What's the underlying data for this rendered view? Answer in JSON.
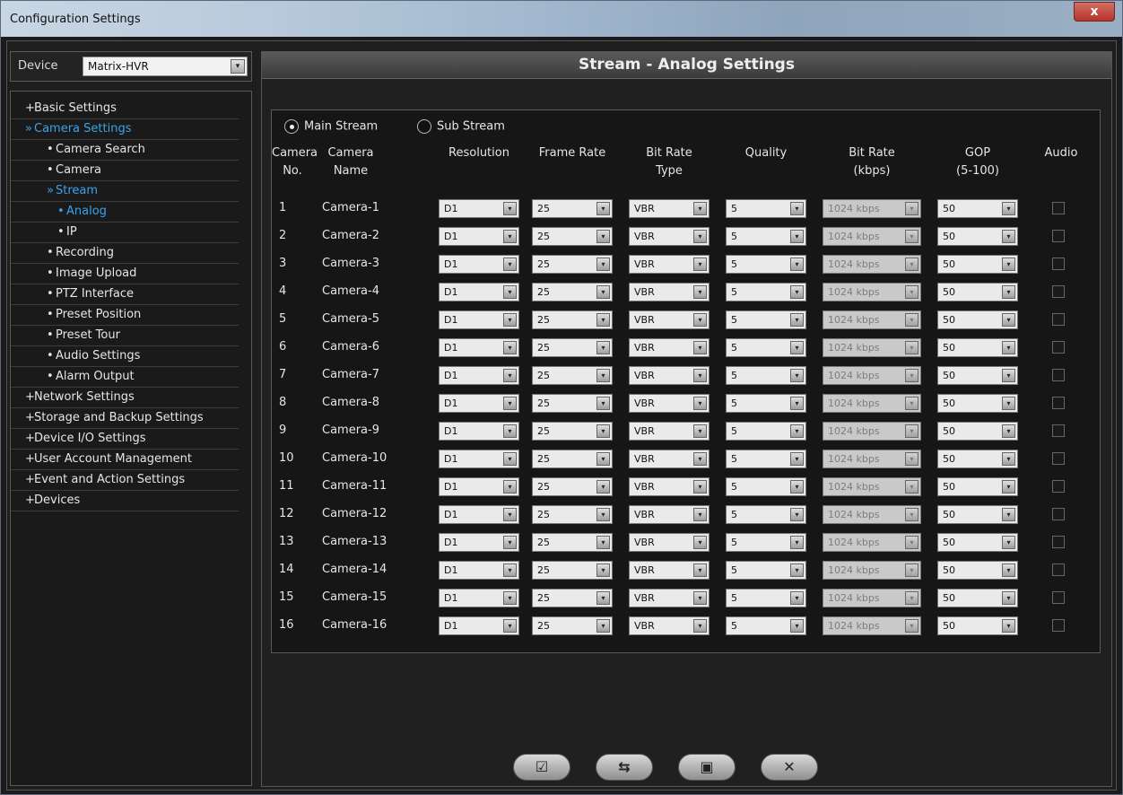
{
  "window": {
    "title": "Configuration Settings",
    "close_glyph": "x"
  },
  "device": {
    "label": "Device",
    "value": "Matrix-HVR",
    "arrow_glyph": "▾"
  },
  "tree": [
    {
      "label": "Basic Settings",
      "bullet": "+",
      "level": 0,
      "active": false
    },
    {
      "label": "Camera Settings",
      "bullet": "»",
      "level": 0,
      "active": true
    },
    {
      "label": "Camera Search",
      "bullet": "•",
      "level": 1,
      "active": false
    },
    {
      "label": "Camera",
      "bullet": "•",
      "level": 1,
      "active": false
    },
    {
      "label": "Stream",
      "bullet": "»",
      "level": 1,
      "active": true
    },
    {
      "label": "Analog",
      "bullet": "•",
      "level": 2,
      "active": true
    },
    {
      "label": "IP",
      "bullet": "•",
      "level": 2,
      "active": false
    },
    {
      "label": "Recording",
      "bullet": "•",
      "level": 1,
      "active": false
    },
    {
      "label": "Image Upload",
      "bullet": "•",
      "level": 1,
      "active": false
    },
    {
      "label": "PTZ Interface",
      "bullet": "•",
      "level": 1,
      "active": false
    },
    {
      "label": "Preset Position",
      "bullet": "•",
      "level": 1,
      "active": false
    },
    {
      "label": "Preset Tour",
      "bullet": "•",
      "level": 1,
      "active": false
    },
    {
      "label": "Audio Settings",
      "bullet": "•",
      "level": 1,
      "active": false
    },
    {
      "label": "Alarm Output",
      "bullet": "•",
      "level": 1,
      "active": false
    },
    {
      "label": "Network Settings",
      "bullet": "+",
      "level": 0,
      "active": false
    },
    {
      "label": "Storage and Backup Settings",
      "bullet": "+",
      "level": 0,
      "active": false
    },
    {
      "label": "Device I/O Settings",
      "bullet": "+",
      "level": 0,
      "active": false
    },
    {
      "label": "User Account Management",
      "bullet": "+",
      "level": 0,
      "active": false
    },
    {
      "label": "Event and Action Settings",
      "bullet": "+",
      "level": 0,
      "active": false
    },
    {
      "label": "Devices",
      "bullet": "+",
      "level": 0,
      "active": false
    }
  ],
  "main": {
    "title": "Stream - Analog Settings",
    "radio_main": "Main Stream",
    "radio_sub": "Sub Stream",
    "selected_stream": "main",
    "headers": {
      "camera_no": "Camera No.",
      "camera_no_l1": "Camera",
      "camera_no_l2": "No.",
      "camera_name_l1": "Camera",
      "camera_name_l2": "Name",
      "resolution": "Resolution",
      "frame_rate": "Frame Rate",
      "bitrate_type_l1": "Bit Rate",
      "bitrate_type_l2": "Type",
      "quality": "Quality",
      "bitrate_l1": "Bit Rate",
      "bitrate_l2": "(kbps)",
      "gop_l1": "GOP",
      "gop_l2": "(5-100)",
      "audio": "Audio"
    },
    "rows": [
      {
        "no": "1",
        "name": "Camera-1",
        "resolution": "D1",
        "frame_rate": "25",
        "bitrate_type": "VBR",
        "quality": "5",
        "bitrate": "1024 kbps",
        "gop": "50",
        "audio": false
      },
      {
        "no": "2",
        "name": "Camera-2",
        "resolution": "D1",
        "frame_rate": "25",
        "bitrate_type": "VBR",
        "quality": "5",
        "bitrate": "1024 kbps",
        "gop": "50",
        "audio": false
      },
      {
        "no": "3",
        "name": "Camera-3",
        "resolution": "D1",
        "frame_rate": "25",
        "bitrate_type": "VBR",
        "quality": "5",
        "bitrate": "1024 kbps",
        "gop": "50",
        "audio": false
      },
      {
        "no": "4",
        "name": "Camera-4",
        "resolution": "D1",
        "frame_rate": "25",
        "bitrate_type": "VBR",
        "quality": "5",
        "bitrate": "1024 kbps",
        "gop": "50",
        "audio": false
      },
      {
        "no": "5",
        "name": "Camera-5",
        "resolution": "D1",
        "frame_rate": "25",
        "bitrate_type": "VBR",
        "quality": "5",
        "bitrate": "1024 kbps",
        "gop": "50",
        "audio": false
      },
      {
        "no": "6",
        "name": "Camera-6",
        "resolution": "D1",
        "frame_rate": "25",
        "bitrate_type": "VBR",
        "quality": "5",
        "bitrate": "1024 kbps",
        "gop": "50",
        "audio": false
      },
      {
        "no": "7",
        "name": "Camera-7",
        "resolution": "D1",
        "frame_rate": "25",
        "bitrate_type": "VBR",
        "quality": "5",
        "bitrate": "1024 kbps",
        "gop": "50",
        "audio": false
      },
      {
        "no": "8",
        "name": "Camera-8",
        "resolution": "D1",
        "frame_rate": "25",
        "bitrate_type": "VBR",
        "quality": "5",
        "bitrate": "1024 kbps",
        "gop": "50",
        "audio": false
      },
      {
        "no": "9",
        "name": "Camera-9",
        "resolution": "D1",
        "frame_rate": "25",
        "bitrate_type": "VBR",
        "quality": "5",
        "bitrate": "1024 kbps",
        "gop": "50",
        "audio": false
      },
      {
        "no": "10",
        "name": "Camera-10",
        "resolution": "D1",
        "frame_rate": "25",
        "bitrate_type": "VBR",
        "quality": "5",
        "bitrate": "1024 kbps",
        "gop": "50",
        "audio": false
      },
      {
        "no": "11",
        "name": "Camera-11",
        "resolution": "D1",
        "frame_rate": "25",
        "bitrate_type": "VBR",
        "quality": "5",
        "bitrate": "1024 kbps",
        "gop": "50",
        "audio": false
      },
      {
        "no": "12",
        "name": "Camera-12",
        "resolution": "D1",
        "frame_rate": "25",
        "bitrate_type": "VBR",
        "quality": "5",
        "bitrate": "1024 kbps",
        "gop": "50",
        "audio": false
      },
      {
        "no": "13",
        "name": "Camera-13",
        "resolution": "D1",
        "frame_rate": "25",
        "bitrate_type": "VBR",
        "quality": "5",
        "bitrate": "1024 kbps",
        "gop": "50",
        "audio": false
      },
      {
        "no": "14",
        "name": "Camera-14",
        "resolution": "D1",
        "frame_rate": "25",
        "bitrate_type": "VBR",
        "quality": "5",
        "bitrate": "1024 kbps",
        "gop": "50",
        "audio": false
      },
      {
        "no": "15",
        "name": "Camera-15",
        "resolution": "D1",
        "frame_rate": "25",
        "bitrate_type": "VBR",
        "quality": "5",
        "bitrate": "1024 kbps",
        "gop": "50",
        "audio": false
      },
      {
        "no": "16",
        "name": "Camera-16",
        "resolution": "D1",
        "frame_rate": "25",
        "bitrate_type": "VBR",
        "quality": "5",
        "bitrate": "1024 kbps",
        "gop": "50",
        "audio": false
      }
    ],
    "footer_buttons": [
      {
        "name": "apply-button",
        "icon": "apply-icon",
        "glyph": "☑"
      },
      {
        "name": "refresh-button",
        "icon": "refresh-icon",
        "glyph": "⇆"
      },
      {
        "name": "save-button",
        "icon": "save-icon",
        "glyph": "▣"
      },
      {
        "name": "cancel-button",
        "icon": "close-icon",
        "glyph": "✕"
      }
    ]
  },
  "colors": {
    "accent": "#3aa3ea",
    "background": "#1e1e1e"
  }
}
